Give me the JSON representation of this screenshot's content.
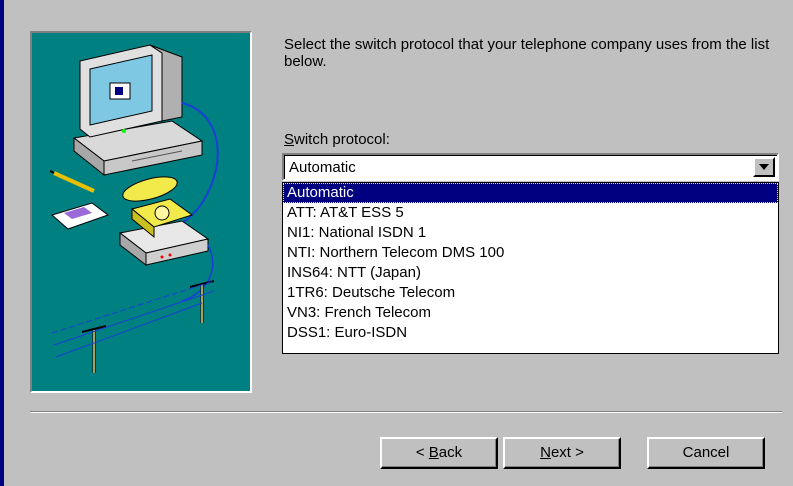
{
  "instruction": "Select the switch protocol that your telephone company uses from the list below.",
  "field_label": {
    "accelerator": "S",
    "rest": "witch protocol:"
  },
  "combo": {
    "value": "Automatic"
  },
  "options": [
    "Automatic",
    "ATT: AT&T ESS 5",
    "NI1: National ISDN 1",
    "NTI: Northern Telecom DMS 100",
    "INS64: NTT (Japan)",
    "1TR6: Deutsche Telecom",
    "VN3: French Telecom",
    "DSS1: Euro-ISDN"
  ],
  "selected_index": 0,
  "buttons": {
    "back": {
      "prefix": "< ",
      "accelerator": "B",
      "rest": "ack"
    },
    "next": {
      "accelerator": "N",
      "rest": "ext >"
    },
    "cancel": "Cancel"
  },
  "colors": {
    "dialog_bg": "#c0c0c0",
    "illustration_bg": "#008080",
    "selection": "#000080"
  },
  "icons": [
    "computer-illustration",
    "telephone-icon",
    "dropdown-arrow-icon"
  ]
}
